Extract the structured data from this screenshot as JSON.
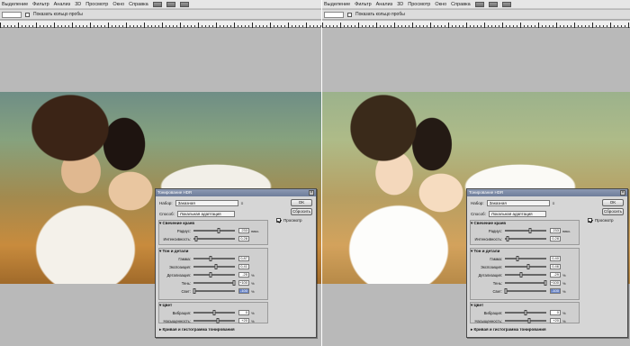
{
  "menu": [
    "Выделение",
    "Фильтр",
    "Анализ",
    "3D",
    "Просмотр",
    "Окно",
    "Справка"
  ],
  "option_bar": {
    "checkbox_label": "Показать кольцо пробы"
  },
  "dialog": {
    "title": "Тонирование HDR",
    "preset_label": "Набор:",
    "preset_value": "Заказная",
    "method_label": "Способ:",
    "method_value": "Локальная адаптация",
    "ok_label": "OK",
    "reset_label": "Сбросить",
    "preview_label": "Просмотр",
    "preview_checked": true,
    "group_edge": "Свечение краев",
    "group_tone": "Тон и детали",
    "group_color": "Цвет",
    "group_curve": "Кривая и гистограмма тонирования"
  },
  "left_dialog": {
    "sliders": [
      {
        "label": "Радиус:",
        "value": "233",
        "unit": "пикс.",
        "fraction": 0.62,
        "highlight": false
      },
      {
        "label": "Интенсивность:",
        "value": "0,28",
        "unit": "",
        "fraction": 0.05,
        "highlight": false
      },
      {
        "label": "Гамма:",
        "value": "0,87",
        "unit": "",
        "fraction": 0.42,
        "highlight": false
      },
      {
        "label": "Экспозиция:",
        "value": "0,41",
        "unit": "",
        "fraction": 0.55,
        "highlight": false
      },
      {
        "label": "Детализация:",
        "value": "-25",
        "unit": "%",
        "fraction": 0.4,
        "highlight": false
      },
      {
        "label": "Тень:",
        "value": "+100",
        "unit": "%",
        "fraction": 1.0,
        "highlight": false
      },
      {
        "label": "Свет:",
        "value": "-100",
        "unit": "%",
        "fraction": 0.0,
        "highlight": true
      },
      {
        "label": "Вибрация:",
        "value": "0",
        "unit": "%",
        "fraction": 0.5,
        "highlight": false
      },
      {
        "label": "Насыщенность:",
        "value": "+20",
        "unit": "%",
        "fraction": 0.6,
        "highlight": false
      }
    ]
  },
  "right_dialog": {
    "sliders": [
      {
        "label": "Радиус:",
        "value": "233",
        "unit": "пикс.",
        "fraction": 0.62,
        "highlight": false
      },
      {
        "label": "Интенсивность:",
        "value": "0,28",
        "unit": "",
        "fraction": 0.05,
        "highlight": false
      },
      {
        "label": "Гамма:",
        "value": "0,40",
        "unit": "",
        "fraction": 0.3,
        "highlight": false
      },
      {
        "label": "Экспозиция:",
        "value": "0,46",
        "unit": "",
        "fraction": 0.56,
        "highlight": false
      },
      {
        "label": "Детализация:",
        "value": "-29",
        "unit": "%",
        "fraction": 0.38,
        "highlight": false
      },
      {
        "label": "Тень:",
        "value": "+100",
        "unit": "%",
        "fraction": 1.0,
        "highlight": false
      },
      {
        "label": "Свет:",
        "value": "-100",
        "unit": "%",
        "fraction": 0.0,
        "highlight": true
      },
      {
        "label": "Вибрация:",
        "value": "0",
        "unit": "%",
        "fraction": 0.5,
        "highlight": false
      },
      {
        "label": "Насыщенность:",
        "value": "+20",
        "unit": "%",
        "fraction": 0.6,
        "highlight": false
      }
    ]
  }
}
